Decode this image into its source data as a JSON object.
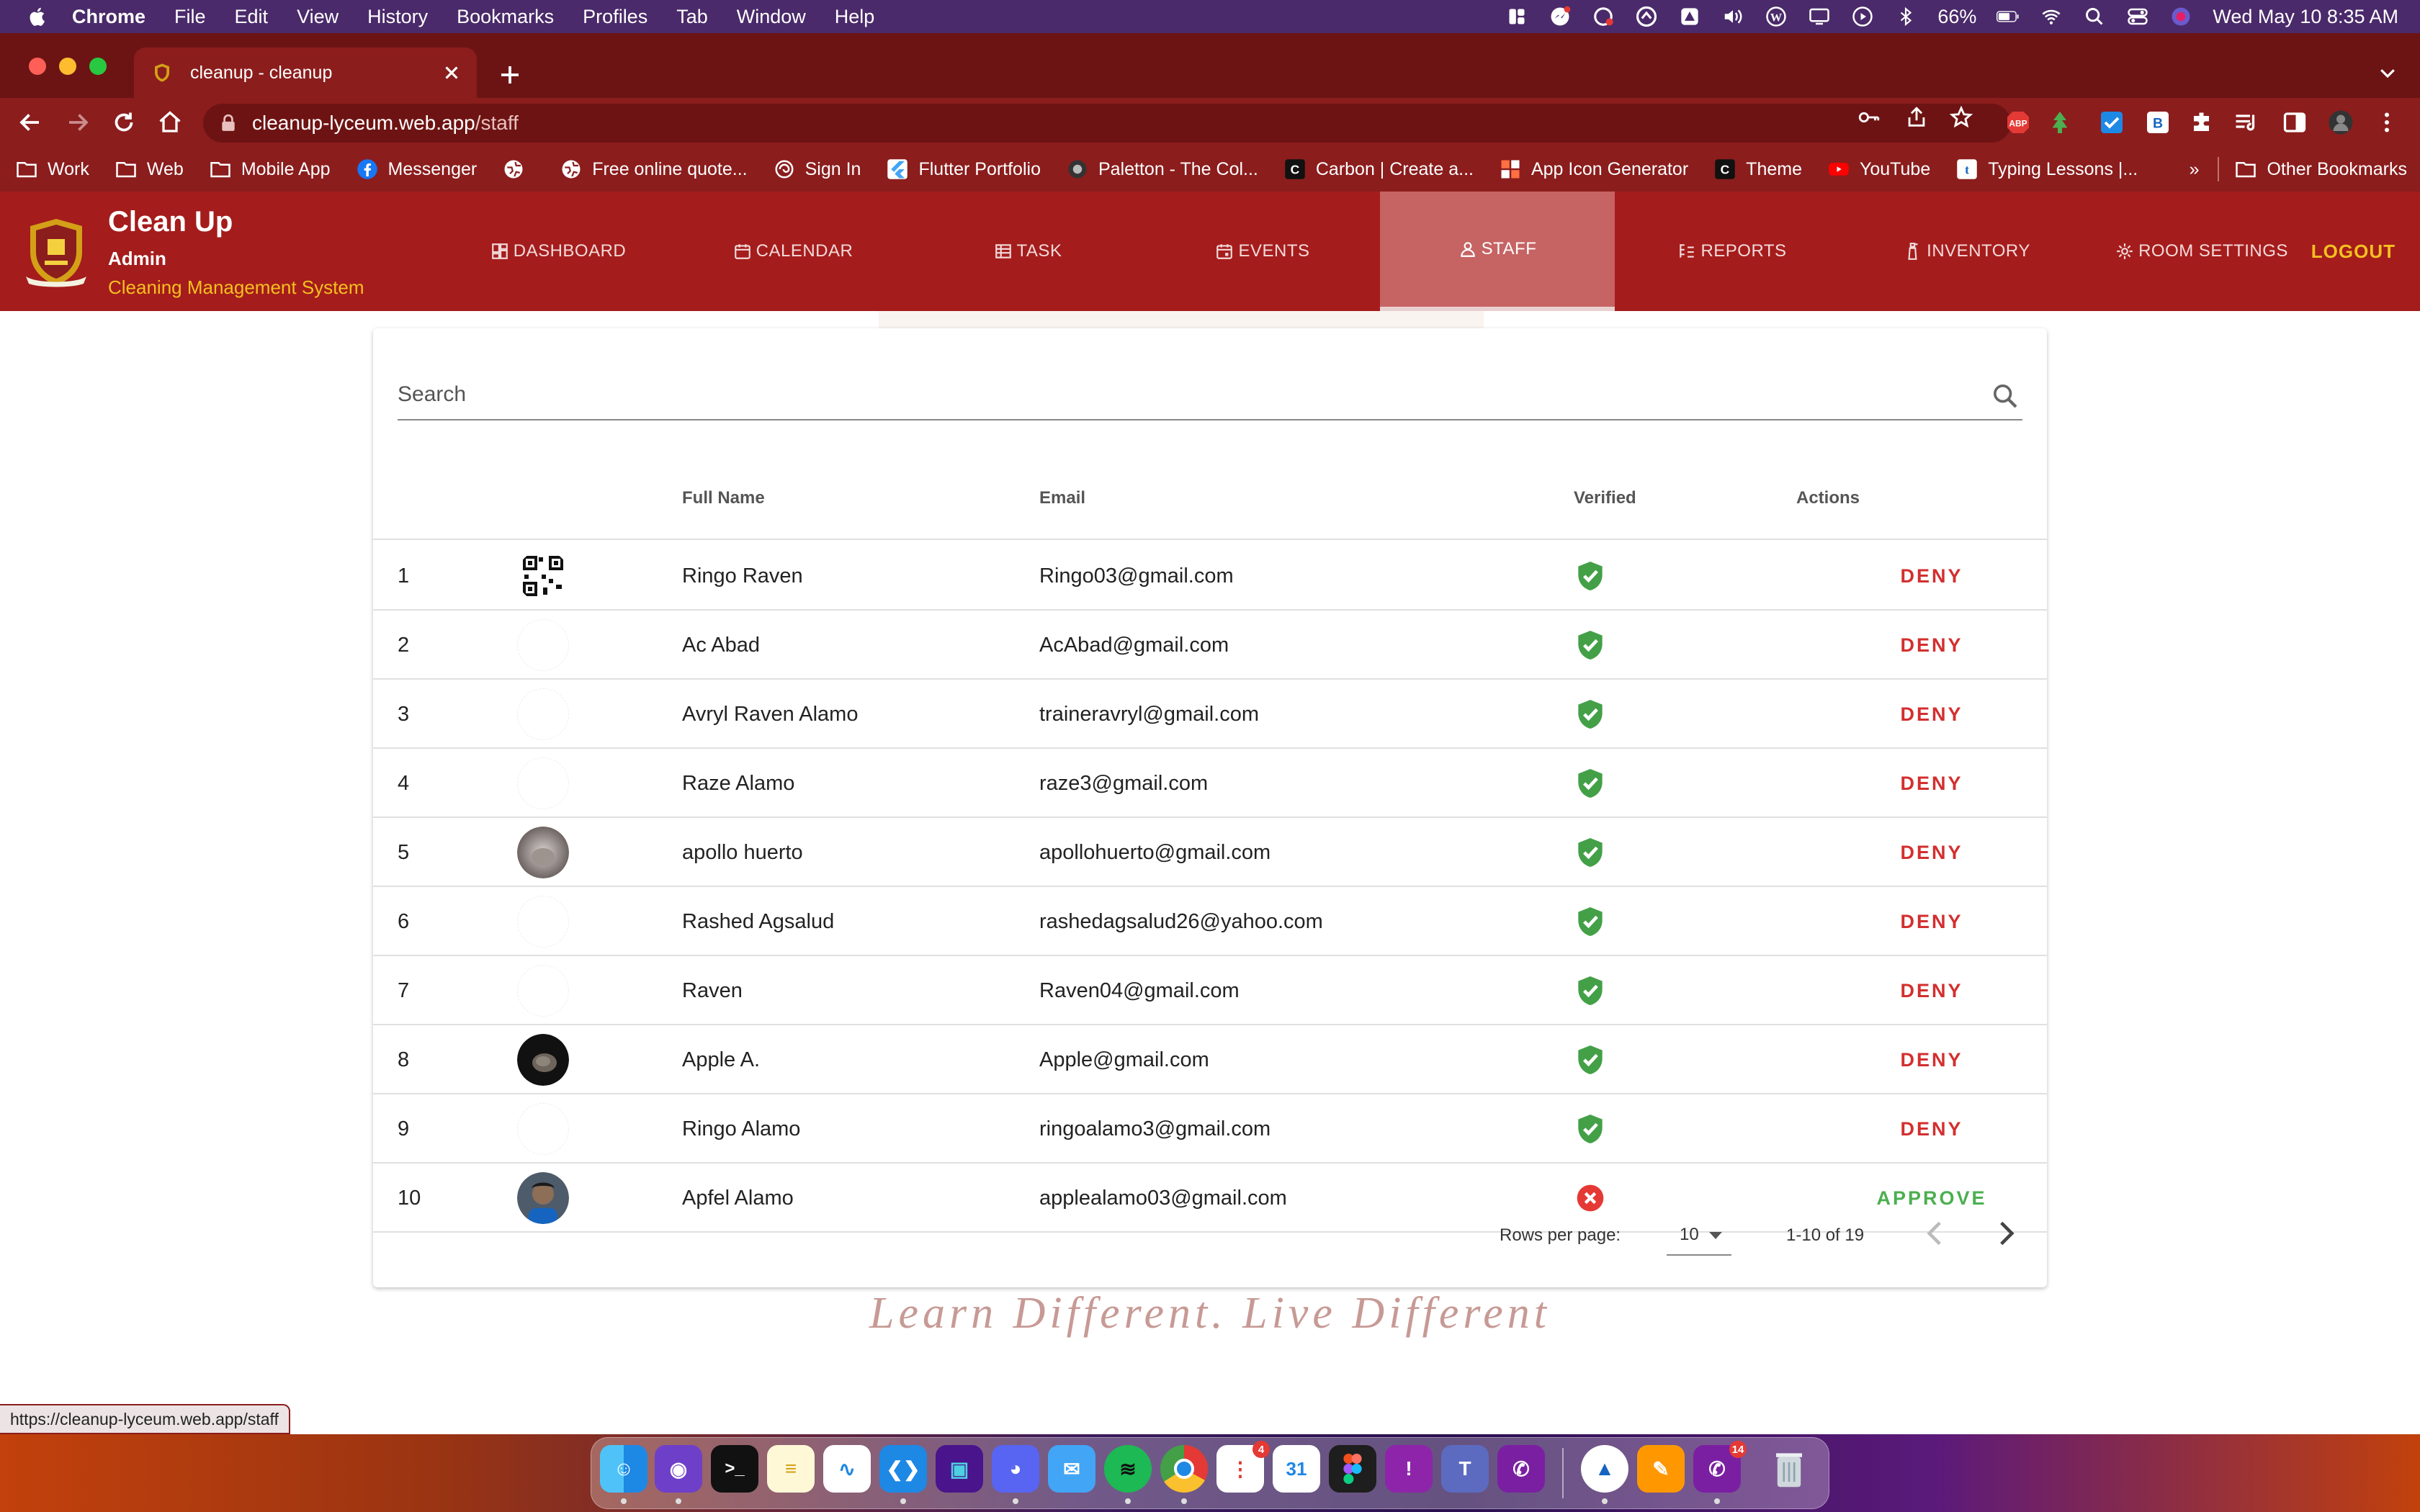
{
  "menubar": {
    "app": "Chrome",
    "items": [
      "File",
      "Edit",
      "View",
      "History",
      "Bookmarks",
      "Profiles",
      "Tab",
      "Window",
      "Help"
    ],
    "battery": "66%",
    "datetime": "Wed May 10  8:35 AM"
  },
  "browser": {
    "tab_title": "cleanup - cleanup",
    "url_host": "cleanup-lyceum.web.app",
    "url_path": "/staff",
    "status_url": "https://cleanup-lyceum.web.app/staff",
    "extension_abp": "ABP",
    "extension_b": "B"
  },
  "bookmarks": {
    "items": [
      "Work",
      "Web",
      "Mobile App",
      "Messenger",
      "",
      "Free online quote...",
      "Sign In",
      "Flutter Portfolio",
      "Paletton - The Col...",
      "Carbon | Create a...",
      "App Icon Generator",
      "Theme",
      "YouTube",
      "Typing Lessons |..."
    ],
    "overflow": "»",
    "other": "Other Bookmarks"
  },
  "app": {
    "title": "Clean Up",
    "role": "Admin",
    "tagline": "Cleaning Management System",
    "nav": [
      "DASHBOARD",
      "CALENDAR",
      "TASK",
      "EVENTS",
      "STAFF",
      "REPORTS",
      "INVENTORY",
      "ROOM SETTINGS"
    ],
    "active_nav": "STAFF",
    "logout": "LOGOUT",
    "colors": {
      "primary": "#a51c1c",
      "accent": "#f4c020",
      "deny": "#d32f2f",
      "approve": "#4caf50"
    }
  },
  "search": {
    "placeholder": "Search"
  },
  "table": {
    "columns": [
      "",
      "",
      "Full Name",
      "Email",
      "Verified",
      "Actions"
    ],
    "rows": [
      {
        "no": "1",
        "avatar": "qr-code",
        "name": "Ringo Raven",
        "email": "Ringo03@gmail.com",
        "verified": true,
        "action": "DENY"
      },
      {
        "no": "2",
        "avatar": "none",
        "name": "Ac Abad",
        "email": "AcAbad@gmail.com",
        "verified": true,
        "action": "DENY"
      },
      {
        "no": "3",
        "avatar": "none",
        "name": "Avryl Raven Alamo",
        "email": "traineravryl@gmail.com",
        "verified": true,
        "action": "DENY"
      },
      {
        "no": "4",
        "avatar": "none",
        "name": "Raze Alamo",
        "email": "raze3@gmail.com",
        "verified": true,
        "action": "DENY"
      },
      {
        "no": "5",
        "avatar": "photo-grey",
        "name": "apollo huerto",
        "email": "apollohuerto@gmail.com",
        "verified": true,
        "action": "DENY"
      },
      {
        "no": "6",
        "avatar": "none",
        "name": "Rashed Agsalud",
        "email": "rashedagsalud26@yahoo.com",
        "verified": true,
        "action": "DENY"
      },
      {
        "no": "7",
        "avatar": "none",
        "name": "Raven",
        "email": "Raven04@gmail.com",
        "verified": true,
        "action": "DENY"
      },
      {
        "no": "8",
        "avatar": "photo-dark",
        "name": "Apple A.",
        "email": "Apple@gmail.com",
        "verified": true,
        "action": "DENY"
      },
      {
        "no": "9",
        "avatar": "none",
        "name": "Ringo Alamo",
        "email": "ringoalamo3@gmail.com",
        "verified": true,
        "action": "DENY"
      },
      {
        "no": "10",
        "avatar": "photo-person",
        "name": "Apfel Alamo",
        "email": "applealamo03@gmail.com",
        "verified": false,
        "action": "APPROVE"
      }
    ]
  },
  "pagination": {
    "rows_per_page_label": "Rows per page:",
    "rows_per_page": "10",
    "range": "1-10 of 19"
  },
  "motto": "Learn Different. Live Different",
  "dock": {
    "badges": {
      "reminders": "4",
      "calendar": "31",
      "viber": "14"
    }
  }
}
